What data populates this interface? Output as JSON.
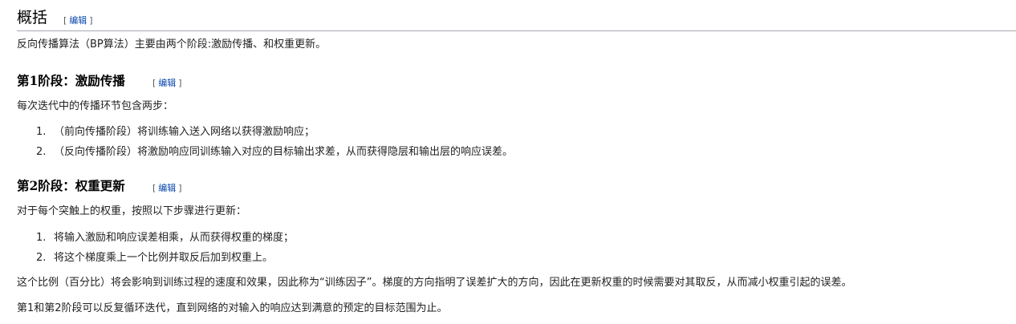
{
  "section": {
    "title": "概括",
    "edit_label": "编辑"
  },
  "intro": "反向传播算法（BP算法）主要由两个阶段:激励传播、和权重更新。",
  "phase1": {
    "title": "第1阶段：激励传播",
    "edit_label": "编辑",
    "intro": "每次迭代中的传播环节包含两步：",
    "steps": [
      {
        "num": "1.",
        "text": "（前向传播阶段）将训练输入送入网络以获得激励响应；"
      },
      {
        "num": "2.",
        "text": "（反向传播阶段）将激励响应同训练输入对应的目标输出求差，从而获得隐层和输出层的响应误差。"
      }
    ]
  },
  "phase2": {
    "title": "第2阶段：权重更新",
    "edit_label": "编辑",
    "intro": "对于每个突触上的权重，按照以下步骤进行更新：",
    "steps": [
      {
        "num": "1.",
        "text": "将输入激励和响应误差相乘，从而获得权重的梯度；"
      },
      {
        "num": "2.",
        "text": "将这个梯度乘上一个比例并取反后加到权重上。"
      }
    ]
  },
  "note1": "这个比例（百分比）将会影响到训练过程的速度和效果，因此称为“训练因子”。梯度的方向指明了误差扩大的方向，因此在更新权重的时候需要对其取反，从而减小权重引起的误差。",
  "note2": "第1和第2阶段可以反复循环迭代，直到网络的对输入的响应达到满意的预定的目标范围为止。"
}
